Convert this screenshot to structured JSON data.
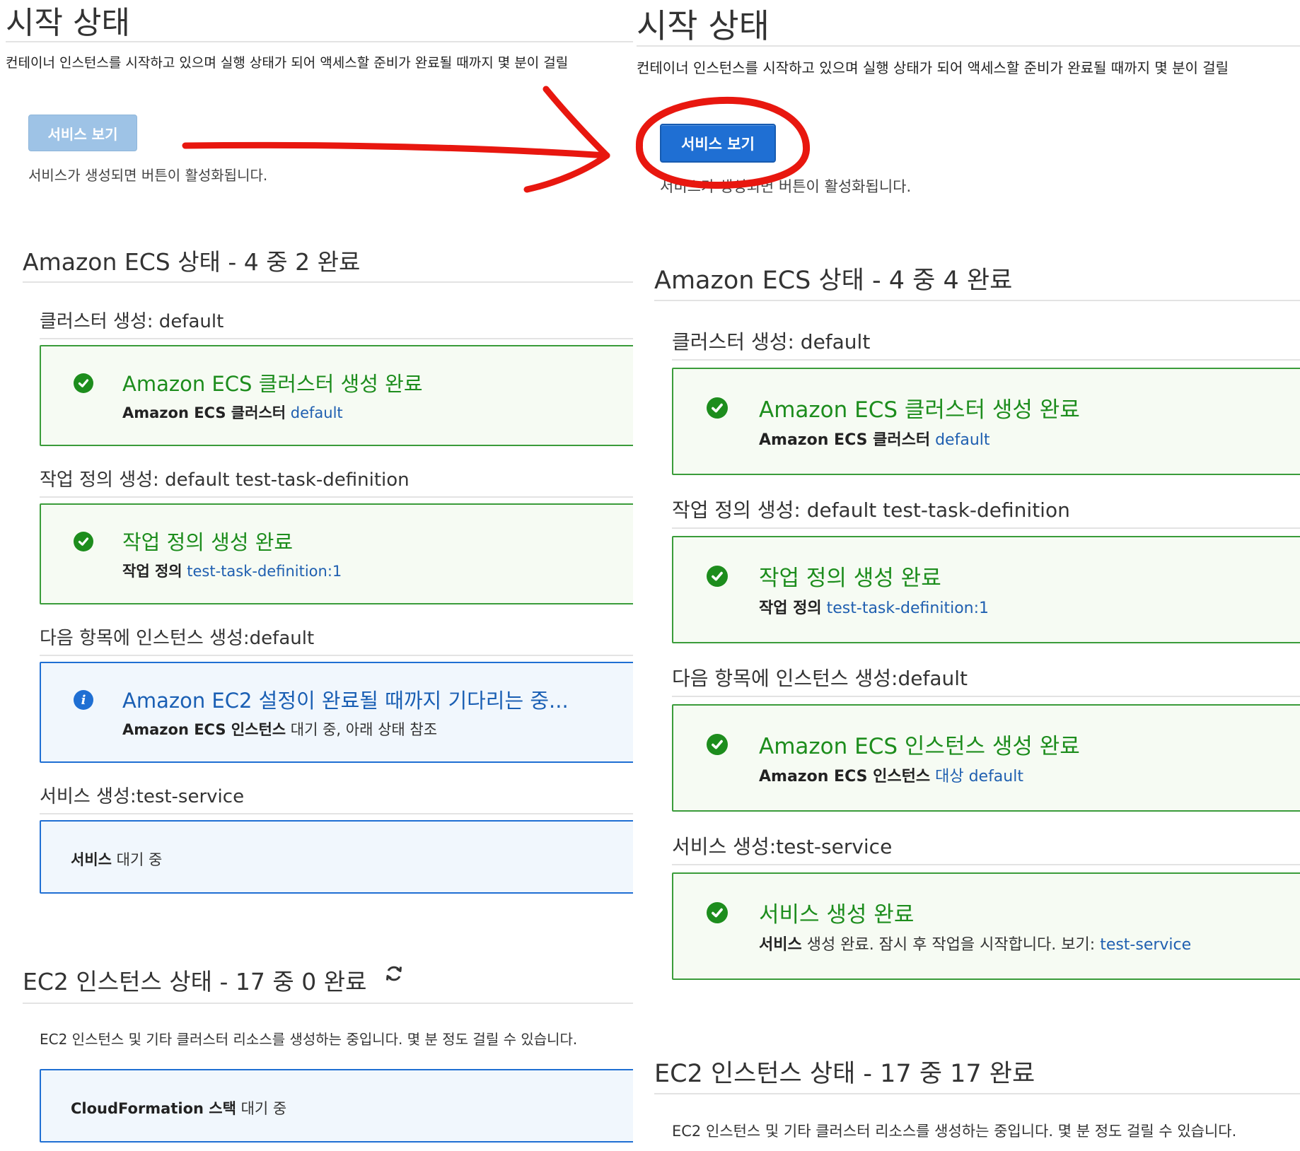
{
  "left": {
    "title": "시작 상태",
    "intro": "컨테이너 인스턴스를 시작하고 있으며 실행 상태가 되어 액세스할 준비가 완료될 때까지 몇 분이 걸릴",
    "view_service_button": "서비스 보기",
    "view_service_button_state": "disabled",
    "button_help": "서비스가 생성되면 버튼이 활성화됩니다.",
    "ecs_section_title": "Amazon ECS 상태 - 4 중 2 완료",
    "steps": [
      {
        "heading": "클러스터 생성: default",
        "status": "success",
        "icon": "check-circle-icon",
        "title": "Amazon ECS 클러스터 생성 완료",
        "detail_bold": "Amazon ECS 클러스터",
        "detail_text": "",
        "detail_link": "default"
      },
      {
        "heading": "작업 정의 생성: default test-task-definition",
        "status": "success",
        "icon": "check-circle-icon",
        "title": "작업 정의 생성 완료",
        "detail_bold": "작업 정의",
        "detail_text": "",
        "detail_link": "test-task-definition:1"
      },
      {
        "heading": "다음 항목에 인스턴스 생성:default",
        "status": "info",
        "icon": "info-circle-icon",
        "title": "Amazon EC2 설정이 완료될 때까지 기다리는 중...",
        "detail_bold": "Amazon ECS 인스턴스",
        "detail_text": "대기 중, 아래 상태 참조",
        "detail_link": ""
      },
      {
        "heading": "서비스 생성:test-service",
        "status": "pending",
        "detail_bold": "서비스",
        "detail_text": "대기 중"
      }
    ],
    "ec2_section_title": "EC2 인스턴스 상태 - 17 중 0 완료",
    "ec2_note": "EC2 인스턴스 및 기타 클러스터 리소스를 생성하는 중입니다. 몇 분 정도 걸릴 수 있습니다.",
    "cloudformation": {
      "detail_bold": "CloudFormation 스택",
      "detail_text": "대기 중"
    }
  },
  "right": {
    "title": "시작 상태",
    "intro": "컨테이너 인스턴스를 시작하고 있으며 실행 상태가 되어 액세스할 준비가 완료될 때까지 몇 분이 걸릴",
    "view_service_button": "서비스 보기",
    "view_service_button_state": "enabled",
    "button_help": "서비스가 생성되면 버튼이 활성화됩니다.",
    "ecs_section_title": "Amazon ECS 상태 - 4 중 4 완료",
    "steps": [
      {
        "heading": "클러스터 생성: default",
        "status": "success",
        "icon": "check-circle-icon",
        "title": "Amazon ECS 클러스터 생성 완료",
        "detail_bold": "Amazon ECS 클러스터",
        "detail_text": "",
        "detail_link": "default"
      },
      {
        "heading": "작업 정의 생성: default test-task-definition",
        "status": "success",
        "icon": "check-circle-icon",
        "title": "작업 정의 생성 완료",
        "detail_bold": "작업 정의",
        "detail_text": "",
        "detail_link": "test-task-definition:1"
      },
      {
        "heading": "다음 항목에 인스턴스 생성:default",
        "status": "success",
        "icon": "check-circle-icon",
        "title": "Amazon ECS 인스턴스 생성 완료",
        "detail_bold": "Amazon ECS 인스턴스",
        "detail_text": "",
        "detail_link": "대상 default"
      },
      {
        "heading": "서비스 생성:test-service",
        "status": "success",
        "icon": "check-circle-icon",
        "title": "서비스 생성 완료",
        "detail_bold": "서비스",
        "detail_text": "생성 완료. 잠시 후 작업을 시작합니다. 보기:",
        "detail_link": "test-service"
      }
    ],
    "ec2_section_title": "EC2 인스턴스 상태 - 17 중 17 완료",
    "ec2_note": "EC2 인스턴스 및 기타 클러스터 리소스를 생성하는 중입니다. 몇 분 정도 걸릴 수 있습니다."
  },
  "icons": {
    "refresh": "refresh-icon",
    "success": "check-circle-icon",
    "info": "info-circle-icon"
  },
  "annotation": {
    "arrow_color": "#e8170f",
    "circle_color": "#e8170f",
    "arrow": "red-arrow-pointing-right",
    "highlight": "red-circle-around-button"
  },
  "colors": {
    "success_green": "#1d8d1d",
    "info_blue": "#1f6fd3",
    "link_blue": "#1f5fb0",
    "button_active": "#1f6fd3",
    "button_disabled": "#9ec3e6"
  }
}
